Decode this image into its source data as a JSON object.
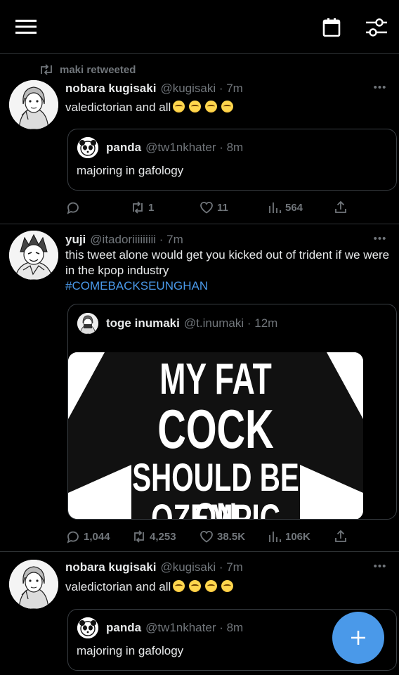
{
  "topbar": {
    "menu_icon": "menu-icon",
    "calendar_icon": "calendar-icon",
    "filter_icon": "sliders-icon"
  },
  "tweets": [
    {
      "retweeted_by": "maki retweeted",
      "name": "nobara kugisaki",
      "handle": "@kugisaki · 7m",
      "text": "valedictorian and all",
      "emoji_count": 4,
      "quote": {
        "name": "panda",
        "handle": "@tw1nkhater · 8m",
        "text": "majoring in gafology"
      },
      "actions": {
        "replies": "",
        "retweets": "1",
        "likes": "11",
        "views": "564"
      }
    },
    {
      "name": "yuji",
      "handle": "@itadoriiiiiiiii · 7m",
      "text": "this tweet alone would get you kicked out of trident if we were in the kpop industry",
      "hashtag": "#COMEBACKSEUNGHAN",
      "quote": {
        "name": "toge inumaki",
        "handle": "@t.inumaki · 12m",
        "image_lines": [
          "MY FAT",
          "COCK",
          "SHOULD BE ON",
          "OZEMPIC"
        ]
      },
      "actions": {
        "replies": "1,044",
        "retweets": "4,253",
        "likes": "38.5K",
        "views": "106K"
      }
    },
    {
      "name": "nobara kugisaki",
      "handle": "@kugisaki · 7m",
      "text": "valedictorian and all",
      "emoji_count": 4,
      "quote": {
        "name": "panda",
        "handle": "@tw1nkhater · 8m",
        "text": "majoring in gafology"
      }
    }
  ],
  "fab": {
    "icon": "plus-icon",
    "color": "#4a99e9"
  },
  "colors": {
    "background": "#000000",
    "text": "#e7e9ea",
    "muted": "#71767b",
    "accent": "#4a99e9"
  }
}
